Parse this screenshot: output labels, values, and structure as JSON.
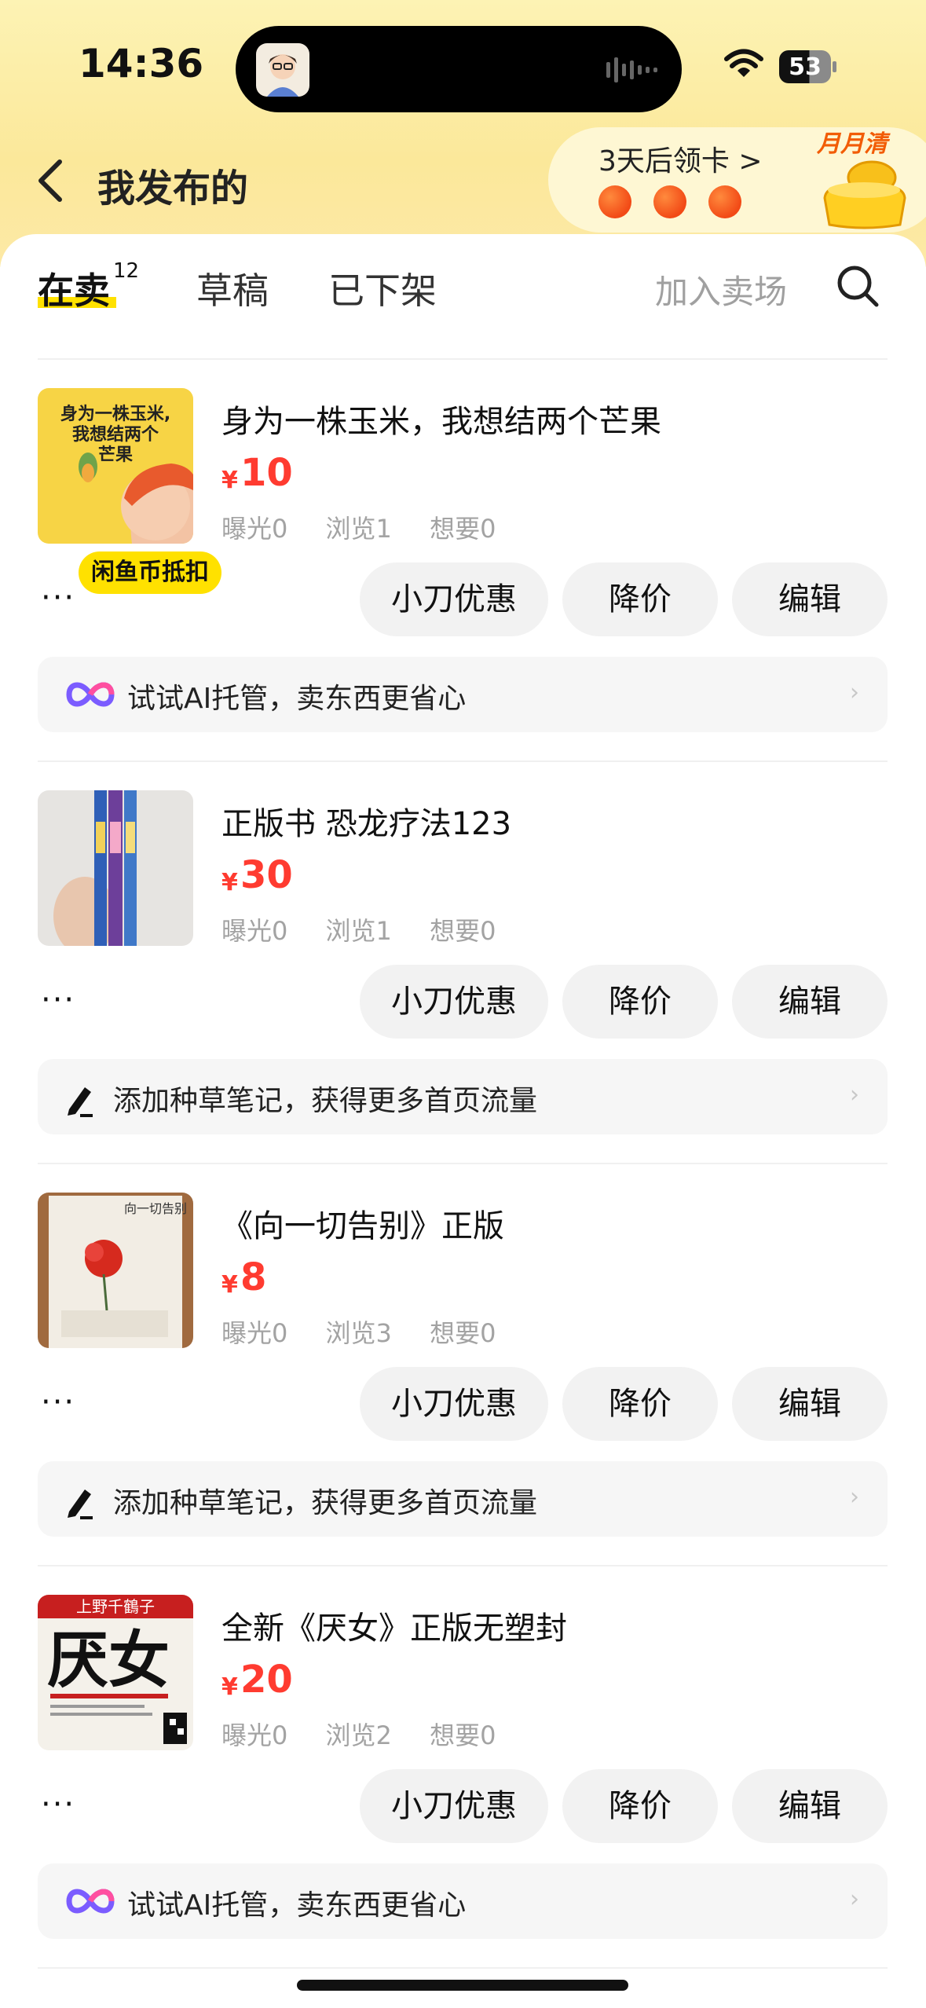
{
  "status": {
    "time": "14:36",
    "battery": "53"
  },
  "header": {
    "title": "我发布的",
    "promo_text": "3天后领卡 >",
    "promo_badge": "月月清"
  },
  "tabs": {
    "items": [
      {
        "label": "在卖",
        "count": "12"
      },
      {
        "label": "草稿"
      },
      {
        "label": "已下架"
      }
    ],
    "join_market": "加入卖场"
  },
  "currency": "¥",
  "actions": {
    "more": "···",
    "discount": "小刀优惠",
    "reduce": "降价",
    "edit": "编辑"
  },
  "items": [
    {
      "title": "身为一株玉米，我想结两个芒果",
      "price": "10",
      "stats": [
        "曝光0",
        "浏览1",
        "想要0"
      ],
      "tag": "闲鱼币抵扣",
      "tip": "试试AI托管，卖东西更省心",
      "tip_icon": "ai-infinity-icon",
      "cover_text": "身为一株玉米，我想结两个芒果"
    },
    {
      "title": "正版书 恐龙疗法123",
      "price": "30",
      "stats": [
        "曝光0",
        "浏览1",
        "想要0"
      ],
      "tip": "添加种草笔记，获得更多首页流量",
      "tip_icon": "pen-icon"
    },
    {
      "title": "《向一切告别》正版",
      "price": "8",
      "stats": [
        "曝光0",
        "浏览3",
        "想要0"
      ],
      "tip": "添加种草笔记，获得更多首页流量",
      "tip_icon": "pen-icon",
      "cover_text": "向一切告别"
    },
    {
      "title": "全新《厌女》正版无塑封",
      "price": "20",
      "stats": [
        "曝光0",
        "浏览2",
        "想要0"
      ],
      "tip": "试试AI托管，卖东西更省心",
      "tip_icon": "ai-infinity-icon",
      "cover_author": "上野千鶴子",
      "cover_title": "厌女"
    }
  ],
  "colors": {
    "accent_yellow": "#ffe100",
    "price_red": "#ff3b30",
    "header_yellow": "#fbe89a"
  }
}
